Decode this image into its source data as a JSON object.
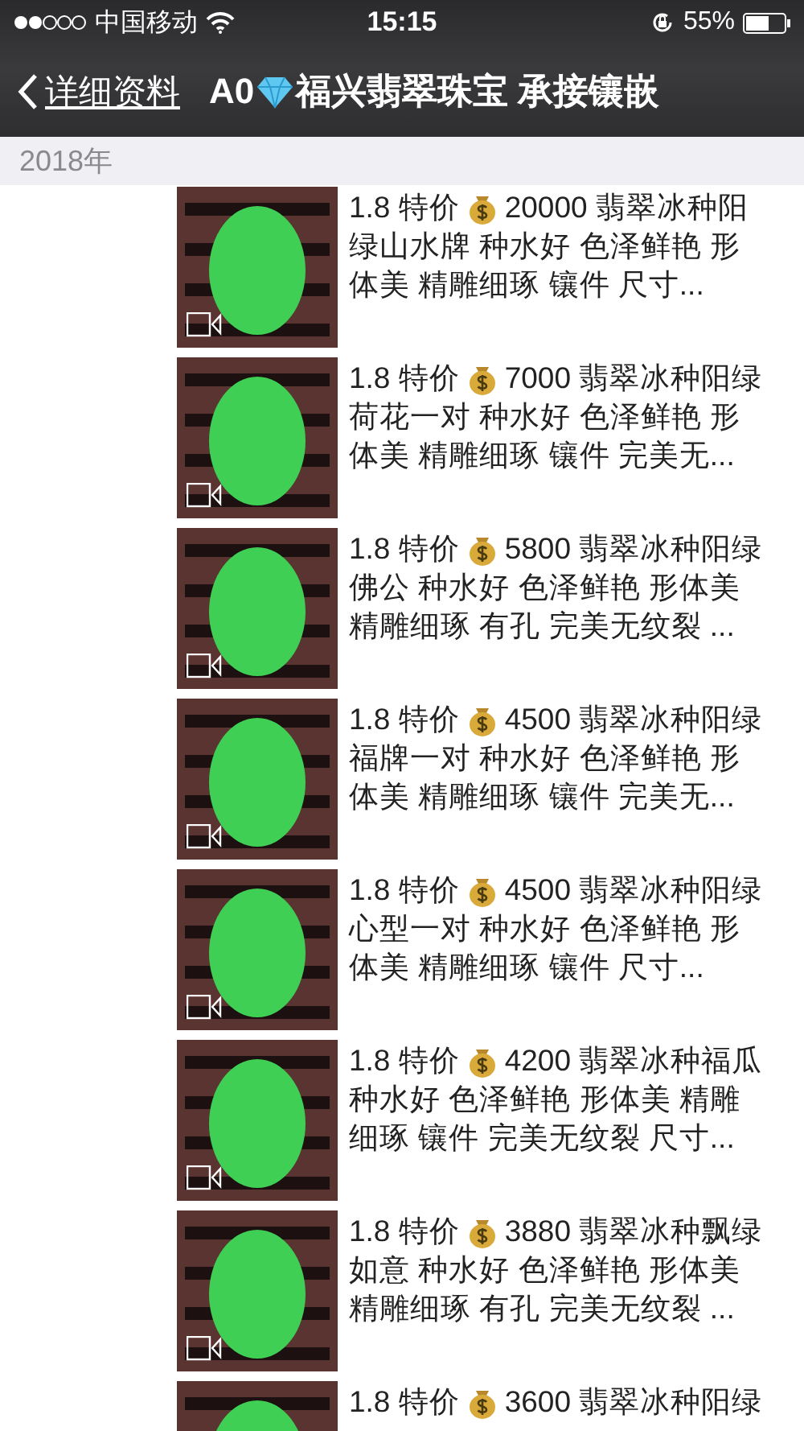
{
  "status_bar": {
    "carrier": "中国移动",
    "time": "15:15",
    "battery": "55%"
  },
  "nav": {
    "back_label": "详细资料",
    "title_prefix": "A0",
    "title": "福兴翡翠珠宝 承接镶嵌"
  },
  "section": {
    "label": "2018年"
  },
  "posts": [
    {
      "price_label": "1.8 特价",
      "first_line": "20000 翡翠冰种阳",
      "video": true,
      "lines": [
        "绿山水牌 种水好 色泽鲜艳 形",
        "体美 精雕细琢 镶件 尺寸..."
      ]
    },
    {
      "price_label": "1.8 特价",
      "first_line": "7000 翡翠冰种阳绿",
      "video": true,
      "lines": [
        "荷花一对 种水好 色泽鲜艳 形",
        "体美 精雕细琢 镶件 完美无..."
      ]
    },
    {
      "price_label": "1.8 特价",
      "first_line": "5800 翡翠冰种阳绿",
      "video": true,
      "lines": [
        "佛公 种水好 色泽鲜艳 形体美",
        "精雕细琢 有孔 完美无纹裂 ..."
      ]
    },
    {
      "price_label": "1.8 特价",
      "first_line": "4500 翡翠冰种阳绿",
      "video": true,
      "lines": [
        "福牌一对 种水好 色泽鲜艳 形",
        "体美 精雕细琢 镶件 完美无..."
      ]
    },
    {
      "price_label": "1.8 特价",
      "first_line": "4500 翡翠冰种阳绿",
      "video": true,
      "lines": [
        "心型一对 种水好 色泽鲜艳 形",
        "体美 精雕细琢 镶件 尺寸..."
      ]
    },
    {
      "price_label": "1.8 特价",
      "first_line": "4200 翡翠冰种福瓜",
      "video": true,
      "lines": [
        "种水好 色泽鲜艳 形体美 精雕",
        "细琢 镶件 完美无纹裂 尺寸..."
      ]
    },
    {
      "price_label": "1.8 特价",
      "first_line": "3880 翡翠冰种飘绿",
      "video": true,
      "lines": [
        "如意 种水好 色泽鲜艳 形体美",
        "精雕细琢 有孔 完美无纹裂 ..."
      ]
    },
    {
      "price_label": "1.8 特价",
      "first_line": "3600 翡翠冰种阳绿",
      "video": false
    }
  ]
}
